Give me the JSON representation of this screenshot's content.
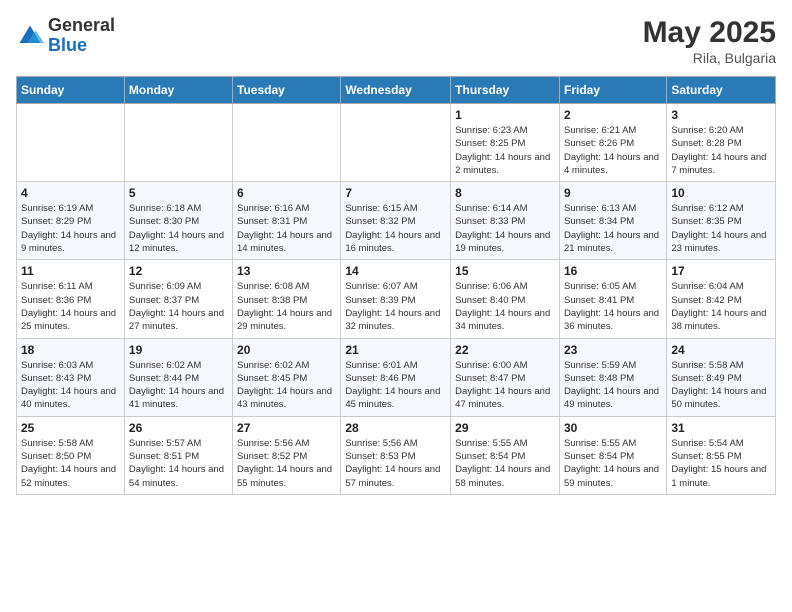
{
  "header": {
    "logo_general": "General",
    "logo_blue": "Blue",
    "month_title": "May 2025",
    "location": "Rila, Bulgaria"
  },
  "days_of_week": [
    "Sunday",
    "Monday",
    "Tuesday",
    "Wednesday",
    "Thursday",
    "Friday",
    "Saturday"
  ],
  "weeks": [
    [
      {
        "num": "",
        "info": ""
      },
      {
        "num": "",
        "info": ""
      },
      {
        "num": "",
        "info": ""
      },
      {
        "num": "",
        "info": ""
      },
      {
        "num": "1",
        "info": "Sunrise: 6:23 AM\nSunset: 8:25 PM\nDaylight: 14 hours and 2 minutes."
      },
      {
        "num": "2",
        "info": "Sunrise: 6:21 AM\nSunset: 8:26 PM\nDaylight: 14 hours and 4 minutes."
      },
      {
        "num": "3",
        "info": "Sunrise: 6:20 AM\nSunset: 8:28 PM\nDaylight: 14 hours and 7 minutes."
      }
    ],
    [
      {
        "num": "4",
        "info": "Sunrise: 6:19 AM\nSunset: 8:29 PM\nDaylight: 14 hours and 9 minutes."
      },
      {
        "num": "5",
        "info": "Sunrise: 6:18 AM\nSunset: 8:30 PM\nDaylight: 14 hours and 12 minutes."
      },
      {
        "num": "6",
        "info": "Sunrise: 6:16 AM\nSunset: 8:31 PM\nDaylight: 14 hours and 14 minutes."
      },
      {
        "num": "7",
        "info": "Sunrise: 6:15 AM\nSunset: 8:32 PM\nDaylight: 14 hours and 16 minutes."
      },
      {
        "num": "8",
        "info": "Sunrise: 6:14 AM\nSunset: 8:33 PM\nDaylight: 14 hours and 19 minutes."
      },
      {
        "num": "9",
        "info": "Sunrise: 6:13 AM\nSunset: 8:34 PM\nDaylight: 14 hours and 21 minutes."
      },
      {
        "num": "10",
        "info": "Sunrise: 6:12 AM\nSunset: 8:35 PM\nDaylight: 14 hours and 23 minutes."
      }
    ],
    [
      {
        "num": "11",
        "info": "Sunrise: 6:11 AM\nSunset: 8:36 PM\nDaylight: 14 hours and 25 minutes."
      },
      {
        "num": "12",
        "info": "Sunrise: 6:09 AM\nSunset: 8:37 PM\nDaylight: 14 hours and 27 minutes."
      },
      {
        "num": "13",
        "info": "Sunrise: 6:08 AM\nSunset: 8:38 PM\nDaylight: 14 hours and 29 minutes."
      },
      {
        "num": "14",
        "info": "Sunrise: 6:07 AM\nSunset: 8:39 PM\nDaylight: 14 hours and 32 minutes."
      },
      {
        "num": "15",
        "info": "Sunrise: 6:06 AM\nSunset: 8:40 PM\nDaylight: 14 hours and 34 minutes."
      },
      {
        "num": "16",
        "info": "Sunrise: 6:05 AM\nSunset: 8:41 PM\nDaylight: 14 hours and 36 minutes."
      },
      {
        "num": "17",
        "info": "Sunrise: 6:04 AM\nSunset: 8:42 PM\nDaylight: 14 hours and 38 minutes."
      }
    ],
    [
      {
        "num": "18",
        "info": "Sunrise: 6:03 AM\nSunset: 8:43 PM\nDaylight: 14 hours and 40 minutes."
      },
      {
        "num": "19",
        "info": "Sunrise: 6:02 AM\nSunset: 8:44 PM\nDaylight: 14 hours and 41 minutes."
      },
      {
        "num": "20",
        "info": "Sunrise: 6:02 AM\nSunset: 8:45 PM\nDaylight: 14 hours and 43 minutes."
      },
      {
        "num": "21",
        "info": "Sunrise: 6:01 AM\nSunset: 8:46 PM\nDaylight: 14 hours and 45 minutes."
      },
      {
        "num": "22",
        "info": "Sunrise: 6:00 AM\nSunset: 8:47 PM\nDaylight: 14 hours and 47 minutes."
      },
      {
        "num": "23",
        "info": "Sunrise: 5:59 AM\nSunset: 8:48 PM\nDaylight: 14 hours and 49 minutes."
      },
      {
        "num": "24",
        "info": "Sunrise: 5:58 AM\nSunset: 8:49 PM\nDaylight: 14 hours and 50 minutes."
      }
    ],
    [
      {
        "num": "25",
        "info": "Sunrise: 5:58 AM\nSunset: 8:50 PM\nDaylight: 14 hours and 52 minutes."
      },
      {
        "num": "26",
        "info": "Sunrise: 5:57 AM\nSunset: 8:51 PM\nDaylight: 14 hours and 54 minutes."
      },
      {
        "num": "27",
        "info": "Sunrise: 5:56 AM\nSunset: 8:52 PM\nDaylight: 14 hours and 55 minutes."
      },
      {
        "num": "28",
        "info": "Sunrise: 5:56 AM\nSunset: 8:53 PM\nDaylight: 14 hours and 57 minutes."
      },
      {
        "num": "29",
        "info": "Sunrise: 5:55 AM\nSunset: 8:54 PM\nDaylight: 14 hours and 58 minutes."
      },
      {
        "num": "30",
        "info": "Sunrise: 5:55 AM\nSunset: 8:54 PM\nDaylight: 14 hours and 59 minutes."
      },
      {
        "num": "31",
        "info": "Sunrise: 5:54 AM\nSunset: 8:55 PM\nDaylight: 15 hours and 1 minute."
      }
    ]
  ]
}
